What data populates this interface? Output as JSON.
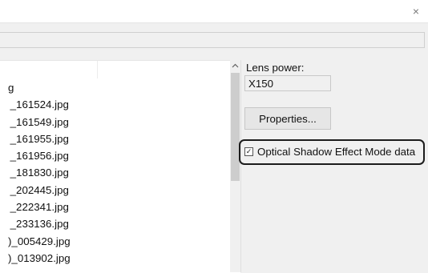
{
  "window": {
    "close_glyph": "×"
  },
  "files": {
    "items": [
      "g",
      " _161524.jpg",
      " _161549.jpg",
      " _161955.jpg",
      " _161956.jpg",
      " _181830.jpg",
      " _202445.jpg",
      " _222341.jpg",
      " _233136.jpg",
      ")_005429.jpg",
      ")_013902.jpg"
    ]
  },
  "right_panel": {
    "lens_label": "Lens power:",
    "lens_value": "X150",
    "properties_label": "Properties...",
    "optical_shadow_label": "Optical Shadow Effect Mode data",
    "optical_shadow_checked": true,
    "check_glyph": "✓"
  }
}
